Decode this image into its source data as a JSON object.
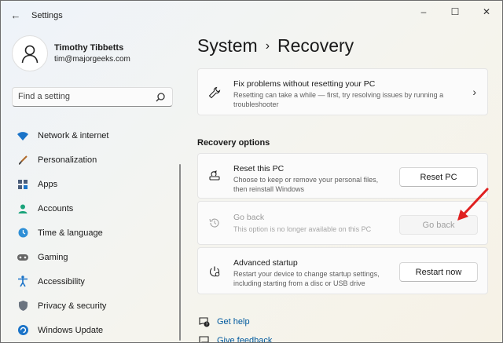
{
  "window": {
    "title": "Settings",
    "back_icon": "back-arrow-icon",
    "controls": {
      "minimize": "–",
      "maximize": "☐",
      "close": "✕"
    }
  },
  "profile": {
    "name": "Timothy Tibbetts",
    "email": "tim@majorgeeks.com"
  },
  "search": {
    "placeholder": "Find a setting"
  },
  "sidebar": {
    "items": [
      {
        "label": "Network & internet",
        "icon": "wifi-icon"
      },
      {
        "label": "Personalization",
        "icon": "brush-icon"
      },
      {
        "label": "Apps",
        "icon": "apps-icon"
      },
      {
        "label": "Accounts",
        "icon": "accounts-icon"
      },
      {
        "label": "Time & language",
        "icon": "globe-clock-icon"
      },
      {
        "label": "Gaming",
        "icon": "gamepad-icon"
      },
      {
        "label": "Accessibility",
        "icon": "accessibility-icon"
      },
      {
        "label": "Privacy & security",
        "icon": "shield-icon"
      },
      {
        "label": "Windows Update",
        "icon": "update-icon"
      }
    ]
  },
  "breadcrumb": {
    "parent": "System",
    "separator": "›",
    "current": "Recovery"
  },
  "fix_card": {
    "title": "Fix problems without resetting your PC",
    "desc_line1": "Resetting can take a while — first, try resolving issues by running a",
    "desc_line2": "troubleshooter"
  },
  "recovery_options": {
    "heading": "Recovery options",
    "reset": {
      "title": "Reset this PC",
      "desc_line1": "Choose to keep or remove your personal files,",
      "desc_line2": "then reinstall Windows",
      "button": "Reset PC"
    },
    "go_back": {
      "title": "Go back",
      "desc": "This option is no longer available on this PC",
      "button": "Go back",
      "disabled": true
    },
    "advanced": {
      "title": "Advanced startup",
      "desc_line1": "Restart your device to change startup settings,",
      "desc_line2": "including starting from a disc or USB drive",
      "button": "Restart now"
    }
  },
  "links": {
    "help": "Get help",
    "feedback": "Give feedback"
  },
  "colors": {
    "accent": "#0067c0",
    "link": "#005a9e",
    "annotation_arrow": "#e02020"
  }
}
